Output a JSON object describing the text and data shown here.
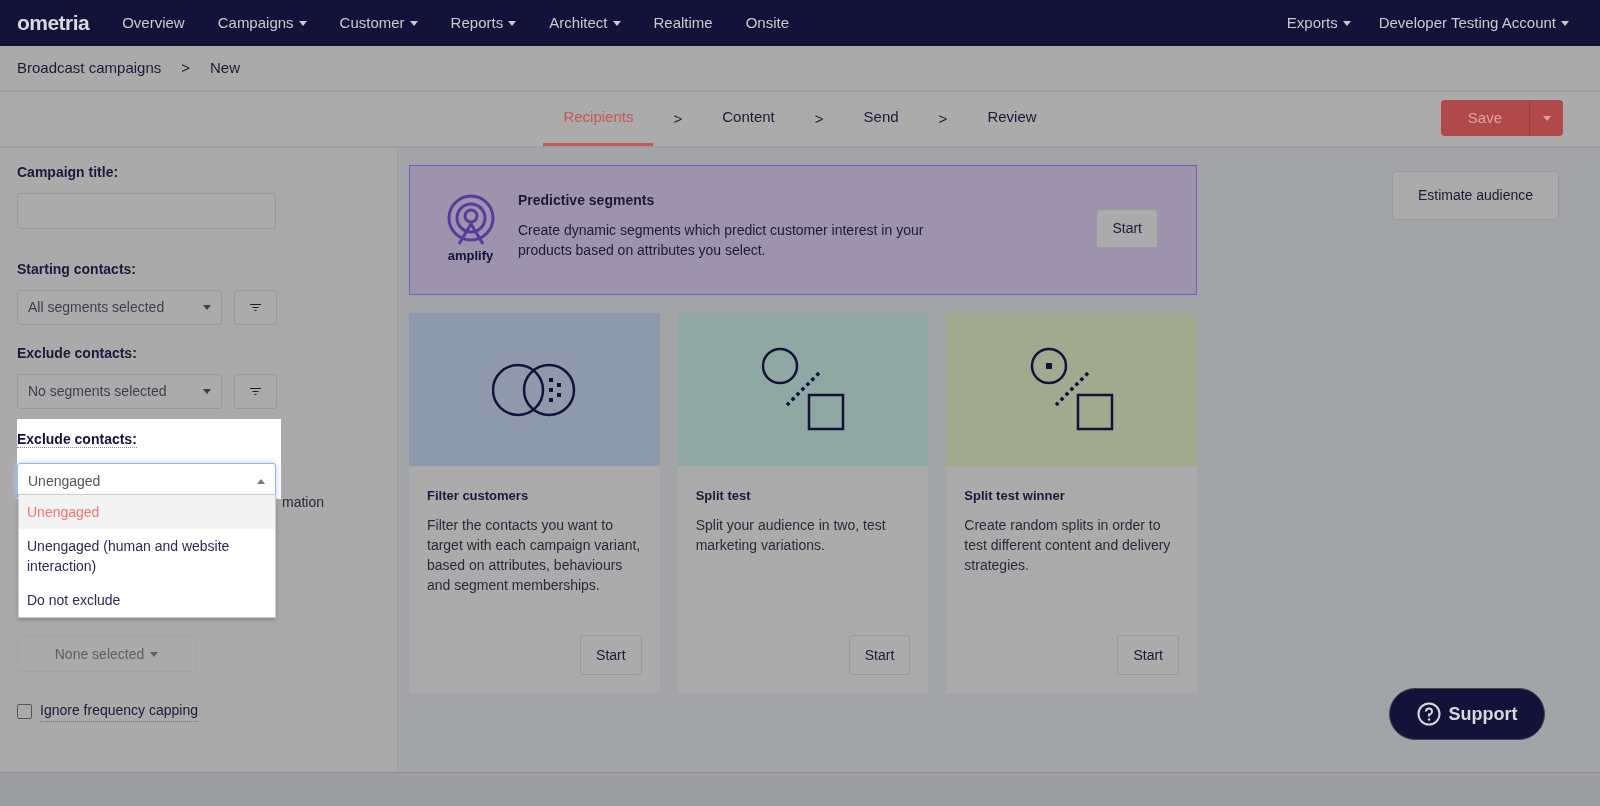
{
  "nav": {
    "logo": "ometria",
    "items": [
      {
        "label": "Overview",
        "caret": false
      },
      {
        "label": "Campaigns",
        "caret": true
      },
      {
        "label": "Customer",
        "caret": true
      },
      {
        "label": "Reports",
        "caret": true
      },
      {
        "label": "Architect",
        "caret": true
      },
      {
        "label": "Realtime",
        "caret": false
      },
      {
        "label": "Onsite",
        "caret": false
      }
    ],
    "right_items": [
      {
        "label": "Exports",
        "caret": true
      },
      {
        "label": "Developer Testing Account",
        "caret": true
      }
    ]
  },
  "breadcrumb": [
    "Broadcast campaigns",
    ">",
    "New"
  ],
  "steps": [
    {
      "label": "Recipients",
      "selected": true
    },
    {
      "label": "Content",
      "selected": false
    },
    {
      "label": "Send",
      "selected": false
    },
    {
      "label": "Review",
      "selected": false
    }
  ],
  "step_separator": ">",
  "save_button": "Save",
  "left_panel": {
    "campaign_title_label": "Campaign title:",
    "starting_label": "Starting contacts:",
    "starting_value": "All segments selected",
    "exclude_label": "Exclude contacts:",
    "exclude_value": "No segments selected",
    "engagement": {
      "label": "Exclude contacts:",
      "value": "Unengaged",
      "expanded": true,
      "options": [
        {
          "label": "Unengaged",
          "selected": true
        },
        {
          "label": "Unengaged (human and website interaction)",
          "selected": false
        },
        {
          "label": "Do not exclude",
          "selected": false
        }
      ]
    },
    "hidden_text": "mation",
    "campaign_select": {
      "label": "None selected",
      "disabled": true
    },
    "frequency_checkbox": {
      "label": "Ignore frequency capping",
      "checked": false
    }
  },
  "banner": {
    "logo_text": "amplify",
    "title": "Predictive segments",
    "description": "Create dynamic segments which predict customer interest in your products based on attributes you select.",
    "button": "Start"
  },
  "cards": [
    {
      "kind": "filter",
      "title": "Filter customers",
      "description": "Filter the contacts you want to target with each campaign variant, based on attributes, behaviours and segment memberships.",
      "button": "Start"
    },
    {
      "kind": "split",
      "title": "Split test",
      "description": "Split your audience in two, test marketing variations.",
      "button": "Start"
    },
    {
      "kind": "winner",
      "title": "Split test winner",
      "description": "Create random splits in order to test different content and delivery strategies.",
      "button": "Start"
    }
  ],
  "estimate_button": "Estimate audience",
  "support_button": "Support"
}
